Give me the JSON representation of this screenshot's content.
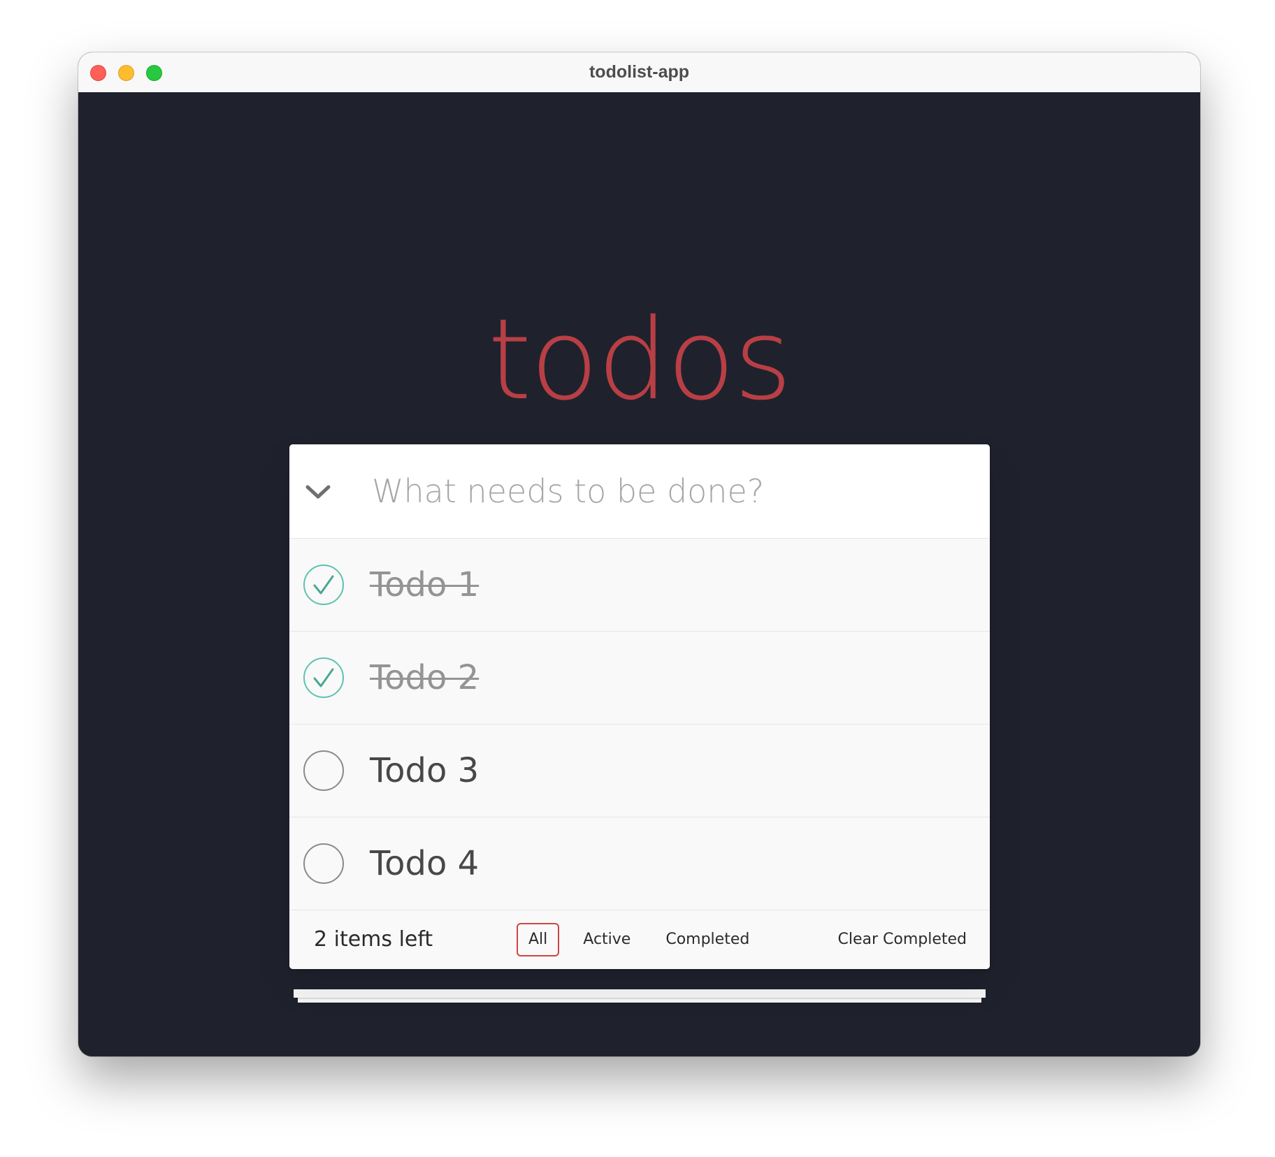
{
  "window": {
    "title": "todolist-app"
  },
  "app": {
    "heading": "todos",
    "heading_color": "#b83f45",
    "background_color": "#1f222d"
  },
  "new_todo": {
    "placeholder": "What needs to be done?",
    "value": ""
  },
  "todos": [
    {
      "label": "Todo 1",
      "completed": true
    },
    {
      "label": "Todo 2",
      "completed": true
    },
    {
      "label": "Todo 3",
      "completed": false
    },
    {
      "label": "Todo 4",
      "completed": false
    }
  ],
  "footer": {
    "count_label": "2 items left",
    "filters": [
      {
        "label": "All",
        "selected": true
      },
      {
        "label": "Active",
        "selected": false
      },
      {
        "label": "Completed",
        "selected": false
      }
    ],
    "clear_completed_label": "Clear Completed"
  },
  "icons": {
    "toggle_all": "chevron-down-icon",
    "completed_toggle": "checked-circle-icon",
    "active_toggle": "empty-circle-icon"
  },
  "colors": {
    "check_accent": "#5dc2af",
    "filter_selected_border": "#ce4646"
  }
}
